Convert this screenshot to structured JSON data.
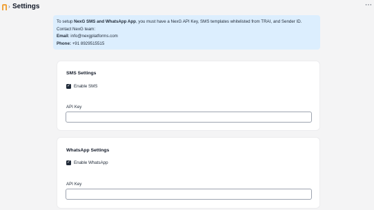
{
  "header": {
    "separator": "›",
    "title": "Settings",
    "more": "⋯",
    "colors": {
      "logo": "#f0a23b"
    }
  },
  "info": {
    "intro_prefix": "To setup ",
    "intro_bold": "NexG SMS and WhatsApp App",
    "intro_suffix": ", you must have a NexG API Key, SMS templates whitelisted from TRAI, and Sender ID.",
    "contact_line": "Contact NexG team:",
    "email_label": "Email:",
    "email_value": " info@nexgplatforms.com",
    "phone_label": "Phone:",
    "phone_value": " +91 8929515515",
    "colors": {
      "background": "#dceefe"
    }
  },
  "sms": {
    "title": "SMS Settings",
    "enable_label": "Enable SMS",
    "enabled": true,
    "api_key_label": "API Key",
    "api_key_value": ""
  },
  "whatsapp": {
    "title": "WhatsApp Settings",
    "enable_label": "Enable WhatsApp",
    "enabled": true,
    "api_key_label": "API Key",
    "api_key_value": ""
  },
  "icons": {
    "check": "✓"
  }
}
